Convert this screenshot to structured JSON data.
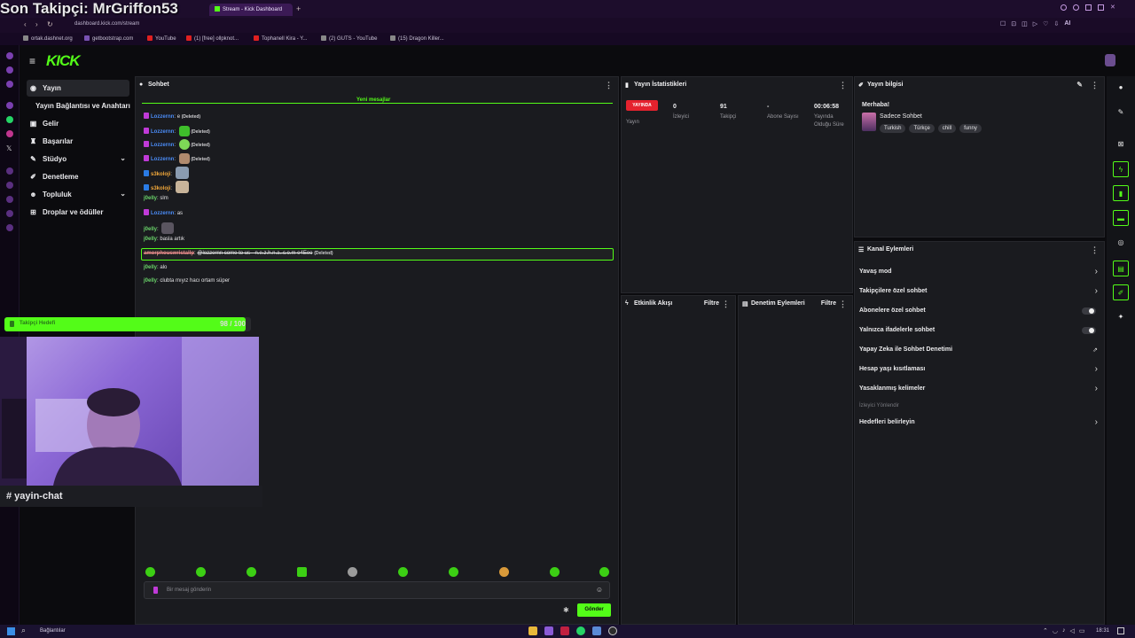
{
  "browser": {
    "tabs": [
      {
        "label": "Stream - Kick Dashboard",
        "active": true
      }
    ],
    "new_tab": "+",
    "url": "dashboard.kick.com/stream",
    "bookmarks": [
      "ortak.dashnet.org",
      "getbootstrap.com",
      "YouTube",
      "(1) [free] ollpknot...",
      "Tophanell Kira - Y...",
      "(2) GUTS - YouTube",
      "(15) Dragon Killer..."
    ],
    "ai_label": "AI"
  },
  "overlay": {
    "last_follower": "Son Takipçi: MrGriffon53",
    "goal_text": "Takipçi Hedefi",
    "goal_count": "98 / 100",
    "goal_progress": 0.98,
    "discord_channel": "# yayin-chat"
  },
  "kick": {
    "logo": "KICK",
    "nav": [
      {
        "label": "Yayın",
        "icon": "broadcast-icon"
      },
      {
        "label": "Yayın Bağlantısı ve Anahtarı",
        "icon": ""
      },
      {
        "label": "Gelir",
        "icon": "dollar-icon"
      },
      {
        "label": "Başarılar",
        "icon": "trophy-icon"
      },
      {
        "label": "Stüdyo",
        "icon": "studio-icon"
      },
      {
        "label": "Denetleme",
        "icon": "wrench-icon"
      },
      {
        "label": "Topluluk",
        "icon": "people-icon"
      },
      {
        "label": "Droplar ve ödüller",
        "icon": "gift-icon"
      }
    ],
    "chat": {
      "title": "Sohbet",
      "new_messages": "Yeni mesajlar",
      "messages": [
        {
          "user": "Lozzernn",
          "text": "e",
          "deleted": "(Deleted)",
          "color": "#4b8cf7"
        },
        {
          "user": "Lozzernn",
          "text": "",
          "deleted": "(Deleted)",
          "color": "#4b8cf7"
        },
        {
          "user": "Lozzernn",
          "text": "",
          "deleted": "(Deleted)",
          "color": "#4b8cf7"
        },
        {
          "user": "Lozzernn",
          "text": "",
          "deleted": "(Deleted)",
          "color": "#4b8cf7"
        },
        {
          "user": "s3koloji",
          "text": "",
          "deleted": "",
          "color": "#f3a93b"
        },
        {
          "user": "s3koloji",
          "text": "",
          "deleted": "",
          "color": "#f3a93b"
        },
        {
          "user": "j0elly",
          "text": "slm",
          "deleted": "",
          "color": "#6ad46a"
        },
        {
          "user": "Lozzernn",
          "text": "as",
          "deleted": "",
          "color": "#4b8cf7"
        },
        {
          "user": "j0elly",
          "text": "",
          "deleted": "",
          "color": "#6ad46a"
        },
        {
          "user": "j0elly",
          "text": "basla artık",
          "deleted": "",
          "color": "#6ad46a"
        },
        {
          "user": "amorphouswristallp",
          "text": "@lozzernn come to us - n.e.z.h.n.a..c.o.m e4Eeo",
          "deleted": "(Deleted)",
          "color": "#e58a8a"
        },
        {
          "user": "j0elly",
          "text": "alo",
          "deleted": "",
          "color": "#6ad46a"
        },
        {
          "user": "j0elly",
          "text": "clubta mıyız hacı ortam süper",
          "deleted": "",
          "color": "#6ad46a"
        }
      ],
      "input_placeholder": "Bir mesaj gönderin",
      "send_button": "Gönder"
    },
    "stats": {
      "title": "Yayın İstatistikleri",
      "items": [
        {
          "value": "YAYINDA",
          "label": "Yayın"
        },
        {
          "value": "0",
          "label": "İzleyici"
        },
        {
          "value": "91",
          "label": "Takipçi"
        },
        {
          "value": "-",
          "label": "Abone Sayısı"
        },
        {
          "value": "00:06:58",
          "label": "Yayında Olduğu Süre"
        }
      ]
    },
    "info": {
      "title": "Yayın bilgisi",
      "stream_title": "Merhaba!",
      "category": "Sadece Sohbet",
      "tags": [
        "Turkish",
        "Türkçe",
        "chill",
        "funny"
      ]
    },
    "activity": {
      "title": "Etkinlik Akışı",
      "filter": "Filtre"
    },
    "modlog": {
      "title": "Denetim Eylemleri",
      "filter": "Filtre"
    },
    "channel_actions": {
      "title": "Kanal Eylemleri",
      "items": [
        {
          "label": "Yavaş mod",
          "control": "arrow"
        },
        {
          "label": "Takipçilere özel sohbet",
          "control": "arrow"
        },
        {
          "label": "Abonelere özel sohbet",
          "control": "toggle"
        },
        {
          "label": "Yalnızca ifadelerle sohbet",
          "control": "toggle"
        },
        {
          "label": "Yapay Zeka ile Sohbet Denetimi",
          "control": "external"
        },
        {
          "label": "Hesap yaşı kısıtlaması",
          "control": "arrow"
        },
        {
          "label": "Yasaklanmış kelimeler",
          "control": "arrow"
        }
      ],
      "section_label": "İzleyici Yönlendir",
      "goals": "Hedefleri belirleyin"
    }
  },
  "taskbar": {
    "search_text": "Bağlantılar",
    "time": "18:31"
  }
}
